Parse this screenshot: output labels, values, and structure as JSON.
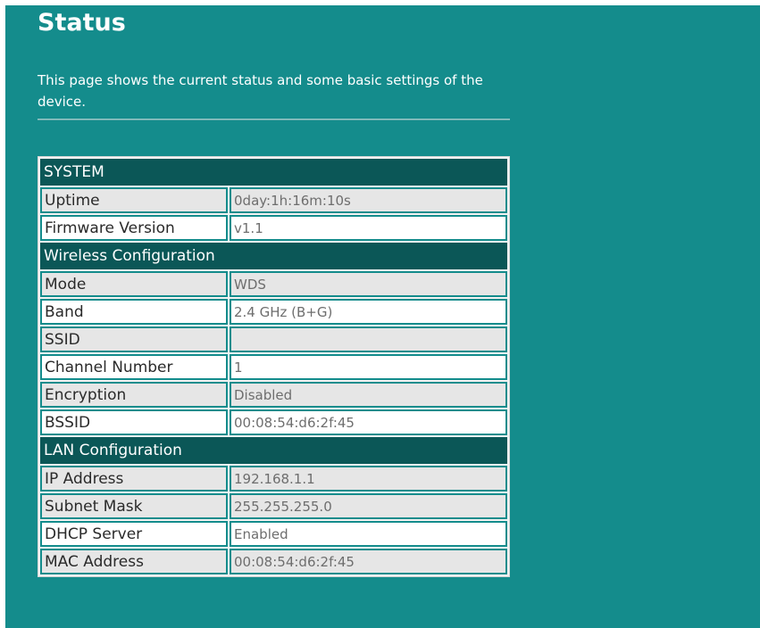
{
  "page": {
    "title": "Status",
    "description": "This page shows the current status and some basic settings of the device."
  },
  "system": {
    "header": "SYSTEM",
    "uptime_label": "Uptime",
    "uptime_value": "0day:1h:16m:10s",
    "firmware_label": "Firmware Version",
    "firmware_value": "v1.1"
  },
  "wireless": {
    "header": "Wireless Configuration",
    "mode_label": "Mode",
    "mode_value": "WDS",
    "band_label": "Band",
    "band_value": "2.4 GHz (B+G)",
    "ssid_label": "SSID",
    "ssid_value": "",
    "channel_label": "Channel Number",
    "channel_value": "1",
    "encryption_label": "Encryption",
    "encryption_value": "Disabled",
    "bssid_label": "BSSID",
    "bssid_value": "00:08:54:d6:2f:45"
  },
  "lan": {
    "header": "LAN Configuration",
    "ip_label": "IP Address",
    "ip_value": "192.168.1.1",
    "subnet_label": "Subnet Mask",
    "subnet_value": "255.255.255.0",
    "dhcp_label": "DHCP Server",
    "dhcp_value": "Enabled",
    "mac_label": "MAC Address",
    "mac_value": "00:08:54:d6:2f:45"
  },
  "colors": {
    "background": "#148c8c",
    "section_header": "#0b5757",
    "row_shaded": "#e6e6e6",
    "row_plain": "#ffffff"
  }
}
